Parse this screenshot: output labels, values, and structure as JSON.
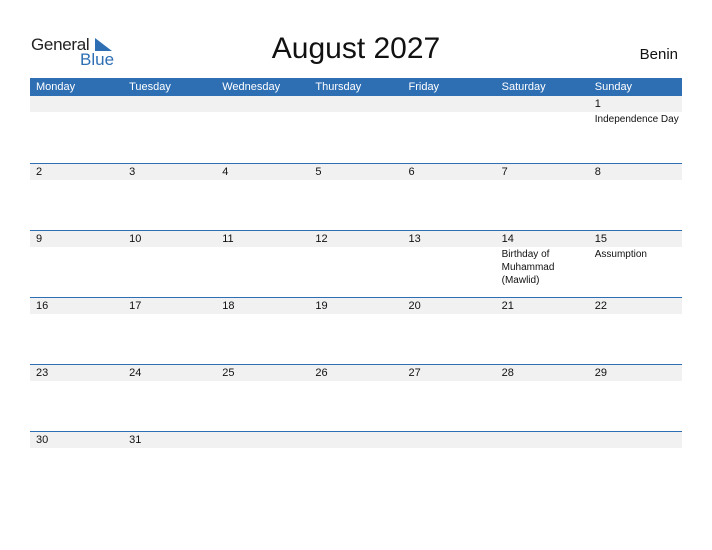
{
  "logo": {
    "general": "General",
    "blue": "Blue"
  },
  "title": "August 2027",
  "country": "Benin",
  "colors": {
    "accent": "#2e6fb4",
    "date_strip": "#f1f1f1"
  },
  "weekdays": [
    "Monday",
    "Tuesday",
    "Wednesday",
    "Thursday",
    "Friday",
    "Saturday",
    "Sunday"
  ],
  "weeks": [
    [
      {
        "n": ""
      },
      {
        "n": ""
      },
      {
        "n": ""
      },
      {
        "n": ""
      },
      {
        "n": ""
      },
      {
        "n": ""
      },
      {
        "n": "1",
        "ev": "Independence Day"
      }
    ],
    [
      {
        "n": "2"
      },
      {
        "n": "3"
      },
      {
        "n": "4"
      },
      {
        "n": "5"
      },
      {
        "n": "6"
      },
      {
        "n": "7"
      },
      {
        "n": "8"
      }
    ],
    [
      {
        "n": "9"
      },
      {
        "n": "10"
      },
      {
        "n": "11"
      },
      {
        "n": "12"
      },
      {
        "n": "13"
      },
      {
        "n": "14",
        "ev": "Birthday of Muhammad (Mawlid)"
      },
      {
        "n": "15",
        "ev": "Assumption"
      }
    ],
    [
      {
        "n": "16"
      },
      {
        "n": "17"
      },
      {
        "n": "18"
      },
      {
        "n": "19"
      },
      {
        "n": "20"
      },
      {
        "n": "21"
      },
      {
        "n": "22"
      }
    ],
    [
      {
        "n": "23"
      },
      {
        "n": "24"
      },
      {
        "n": "25"
      },
      {
        "n": "26"
      },
      {
        "n": "27"
      },
      {
        "n": "28"
      },
      {
        "n": "29"
      }
    ],
    [
      {
        "n": "30"
      },
      {
        "n": "31"
      },
      {
        "n": ""
      },
      {
        "n": ""
      },
      {
        "n": ""
      },
      {
        "n": ""
      },
      {
        "n": ""
      }
    ]
  ]
}
